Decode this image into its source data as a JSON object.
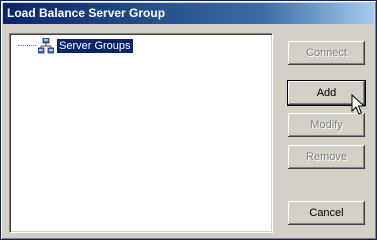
{
  "window": {
    "title": "Load Balance Server Group"
  },
  "tree": {
    "items": [
      {
        "label": "Server Groups",
        "icon": "server-group-icon",
        "selected": true
      }
    ]
  },
  "buttons": {
    "connect": {
      "label": "Connect",
      "enabled": false
    },
    "add": {
      "label": "Add",
      "enabled": true
    },
    "modify": {
      "label": "Modify",
      "enabled": false
    },
    "remove": {
      "label": "Remove",
      "enabled": false
    },
    "cancel": {
      "label": "Cancel",
      "enabled": true
    }
  },
  "colors": {
    "title_bar_start": "#0a246a",
    "title_bar_end": "#a6caf0",
    "face": "#d4d0c8",
    "selection": "#0a246a"
  }
}
